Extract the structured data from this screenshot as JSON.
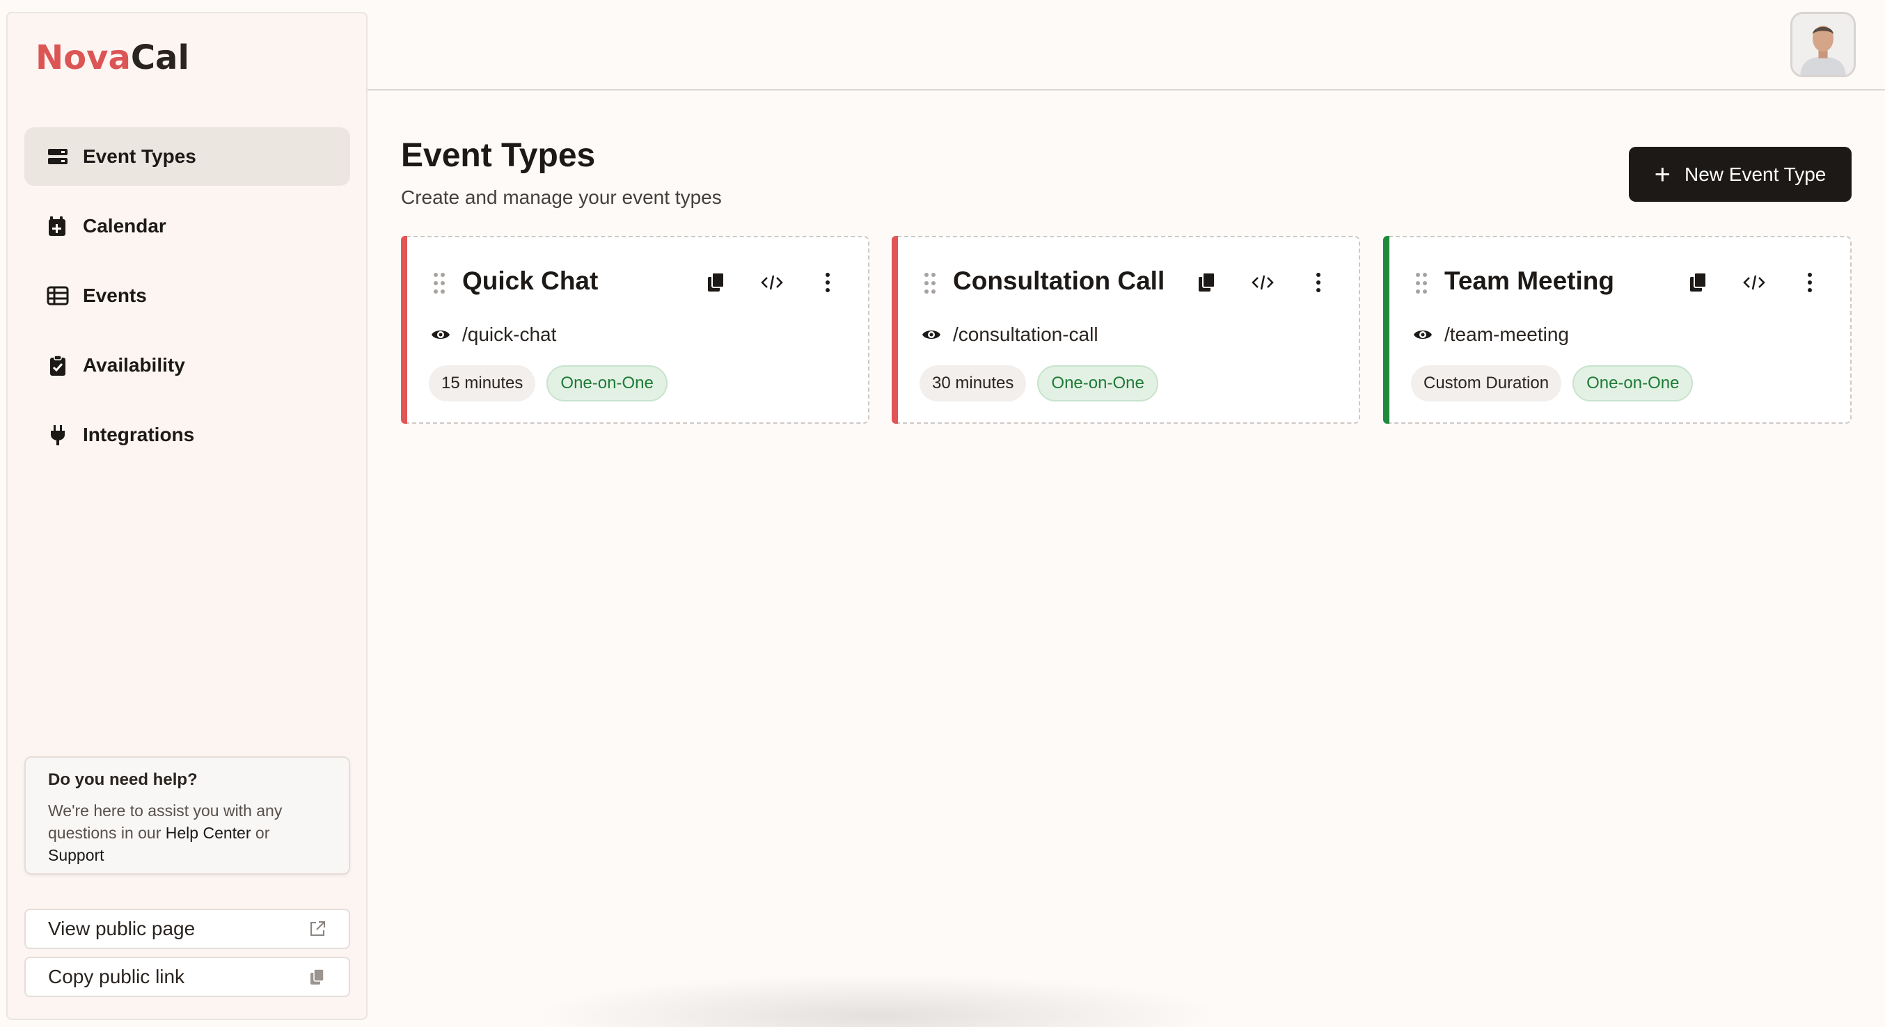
{
  "app": {
    "logo_part1": "Nova",
    "logo_part2": "Cal",
    "brand_color": "#dc5555"
  },
  "sidebar": {
    "items": [
      {
        "label": "Event Types",
        "icon": "server-stack-icon",
        "active": true
      },
      {
        "label": "Calendar",
        "icon": "calendar-plus-icon",
        "active": false
      },
      {
        "label": "Events",
        "icon": "table-list-icon",
        "active": false
      },
      {
        "label": "Availability",
        "icon": "clipboard-check-icon",
        "active": false
      },
      {
        "label": "Integrations",
        "icon": "plug-icon",
        "active": false
      }
    ],
    "help": {
      "title": "Do you need help?",
      "text_before": "We're here to assist you with any questions in our ",
      "link1": "Help Center",
      "text_mid": " or ",
      "link2": "Support"
    },
    "view_public_page": "View public page",
    "copy_public_link": "Copy public link"
  },
  "header": {
    "avatar_icon": "user-avatar"
  },
  "main": {
    "title": "Event Types",
    "subtitle": "Create and manage your event types",
    "new_button": "New Event Type",
    "cards": [
      {
        "title": "Quick Chat",
        "slug": "/quick-chat",
        "duration": "15 minutes",
        "type": "One-on-One",
        "accent": "#e05555"
      },
      {
        "title": "Consultation Call",
        "slug": "/consultation-call",
        "duration": "30 minutes",
        "type": "One-on-One",
        "accent": "#e05555"
      },
      {
        "title": "Team Meeting",
        "slug": "/team-meeting",
        "duration": "Custom Duration",
        "type": "One-on-One",
        "accent": "#1e8a3c"
      }
    ]
  }
}
